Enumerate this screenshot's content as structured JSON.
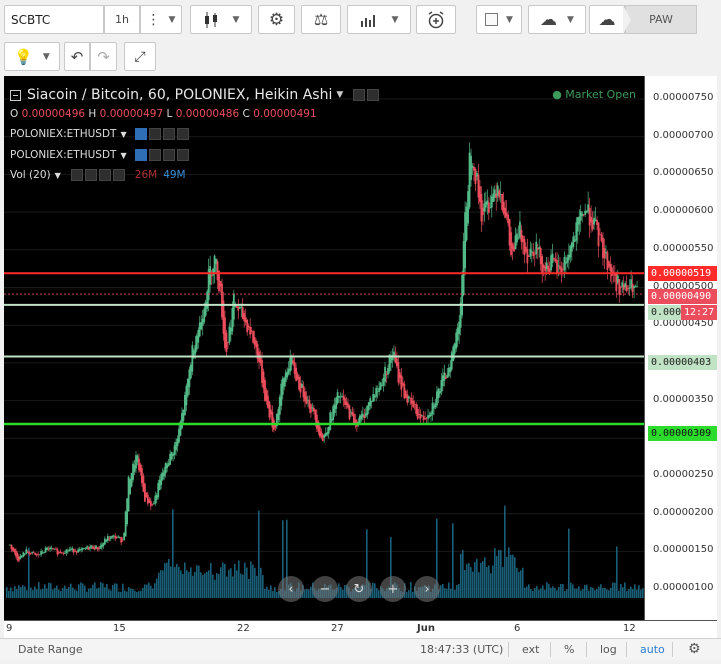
{
  "toolbar": {
    "symbol_value": "SCBTC",
    "interval": "1h",
    "paw_label": "PAW",
    "icons": [
      "dots-vertical-icon",
      "candlestick-icon",
      "gear-icon",
      "scales-icon",
      "bar-chart-icon",
      "alarm-plus-icon",
      "square-icon",
      "cloud-download-icon",
      "cloud-upload-icon",
      "lightbulb-icon",
      "undo-icon",
      "redo-icon",
      "fullscreen-icon"
    ]
  },
  "chart": {
    "title": "Siacoin / Bitcoin, 60, POLONIEX, Heikin Ashi",
    "market_status": "Market Open",
    "ohlc": {
      "o_label": "O",
      "o": "0.00000496",
      "h_label": "H",
      "h": "0.00000497",
      "l_label": "L",
      "l": "0.00000486",
      "c_label": "C",
      "c": "0.00000491"
    },
    "studies": [
      {
        "label": "POLONIEX:ETHUSDT"
      },
      {
        "label": "POLONIEX:ETHUSDT"
      }
    ],
    "volume": {
      "label": "Vol (20)",
      "v1": "26M",
      "v2": "49M"
    },
    "colors": {
      "up": "#53b987",
      "down": "#eb4d5c",
      "red_line": "#ff2a2a",
      "green_line": "#2ddb2d",
      "pale_line": "#bfe3c4",
      "volume": "#1d6e8c",
      "market_open": "#3d9a5b"
    }
  },
  "price_axis": {
    "labels": [
      "0.00000750",
      "0.00000700",
      "0.00000650",
      "0.00000600",
      "0.00000550",
      "0.00000500",
      "0.00000450",
      "0.00000400",
      "0.00000350",
      "0.00000300",
      "0.00000250",
      "0.00000200",
      "0.00000150",
      "0.00000100"
    ],
    "tag_red": "0.00000519",
    "tag_current": "0.00000490",
    "tag_pale": "0.000",
    "countdown": "12:27",
    "tag_403": "0.00000403",
    "tag_309": "0.00000309"
  },
  "time_axis": {
    "labels": [
      "9",
      "15",
      "22",
      "27",
      "Jun",
      "6",
      "12"
    ]
  },
  "bottom_bar": {
    "date_range": "Date Range",
    "clock": "18:47:33 (UTC)",
    "ext": "ext",
    "percent": "%",
    "log": "log",
    "auto": "auto"
  },
  "chart_data": {
    "type": "candlestick",
    "title": "Siacoin / Bitcoin, 60, POLONIEX, Heikin Ashi",
    "x": [
      "9",
      "15",
      "22",
      "27",
      "Jun",
      "6",
      "12"
    ],
    "ylim": [
      7.5e-07,
      7.77e-06
    ],
    "horizontal_lines": [
      5.19e-06,
      4.75e-06,
      4.03e-06,
      3.09e-06
    ],
    "current_price": 4.9e-06,
    "trajectory": [
      [
        0,
        140
      ],
      [
        3,
        120
      ],
      [
        6,
        132
      ],
      [
        10,
        125
      ],
      [
        14,
        136
      ],
      [
        18,
        130
      ],
      [
        22,
        134
      ],
      [
        26,
        132
      ],
      [
        30,
        138
      ],
      [
        33,
        136
      ],
      [
        36,
        150
      ],
      [
        39,
        152
      ],
      [
        42,
        146
      ],
      [
        44,
        230
      ],
      [
        47,
        265
      ],
      [
        50,
        205
      ],
      [
        53,
        195
      ],
      [
        56,
        235
      ],
      [
        59,
        260
      ],
      [
        62,
        285
      ],
      [
        65,
        345
      ],
      [
        68,
        420
      ],
      [
        71,
        455
      ],
      [
        74,
        520
      ],
      [
        76,
        540
      ],
      [
        78,
        495
      ],
      [
        80,
        405
      ],
      [
        83,
        480
      ],
      [
        86,
        460
      ],
      [
        89,
        440
      ],
      [
        92,
        405
      ],
      [
        95,
        340
      ],
      [
        98,
        300
      ],
      [
        101,
        365
      ],
      [
        104,
        400
      ],
      [
        107,
        365
      ],
      [
        110,
        345
      ],
      [
        113,
        320
      ],
      [
        116,
        285
      ],
      [
        119,
        320
      ],
      [
        122,
        350
      ],
      [
        125,
        330
      ],
      [
        128,
        310
      ],
      [
        131,
        320
      ],
      [
        134,
        345
      ],
      [
        137,
        360
      ],
      [
        140,
        390
      ],
      [
        142,
        410
      ],
      [
        144,
        375
      ],
      [
        147,
        345
      ],
      [
        150,
        330
      ],
      [
        153,
        315
      ],
      [
        156,
        330
      ],
      [
        159,
        355
      ],
      [
        162,
        380
      ],
      [
        165,
        420
      ],
      [
        167,
        470
      ],
      [
        169,
        600
      ],
      [
        171,
        700
      ],
      [
        173,
        650
      ],
      [
        175,
        600
      ],
      [
        178,
        620
      ],
      [
        181,
        645
      ],
      [
        184,
        600
      ],
      [
        186,
        540
      ],
      [
        189,
        580
      ],
      [
        192,
        545
      ],
      [
        195,
        560
      ],
      [
        198,
        525
      ],
      [
        201,
        535
      ],
      [
        204,
        520
      ],
      [
        207,
        545
      ],
      [
        210,
        575
      ],
      [
        213,
        610
      ],
      [
        216,
        595
      ],
      [
        219,
        560
      ],
      [
        222,
        530
      ],
      [
        225,
        505
      ],
      [
        228,
        495
      ],
      [
        231,
        500
      ],
      [
        233,
        490
      ]
    ]
  }
}
